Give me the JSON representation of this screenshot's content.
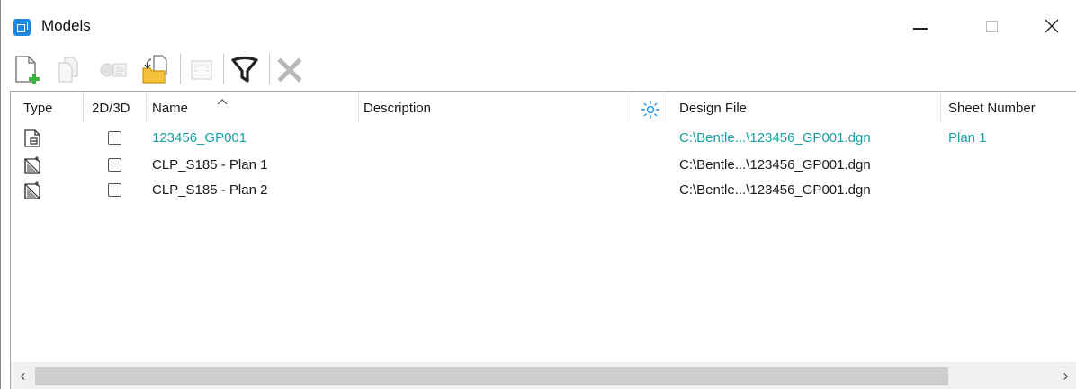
{
  "window": {
    "title": "Models",
    "controls": [
      "minimize",
      "maximize",
      "close"
    ]
  },
  "toolbar": {
    "buttons": [
      {
        "name": "create-model",
        "icon": "new-document-plus-icon",
        "enabled": true
      },
      {
        "name": "copy-model",
        "icon": "copy-icon",
        "enabled": false
      },
      {
        "name": "properties",
        "icon": "info-card-icon",
        "enabled": false
      },
      {
        "name": "import",
        "icon": "folder-import-icon",
        "enabled": true
      },
      {
        "name": "select-all",
        "icon": "select-box-icon",
        "enabled": false
      },
      {
        "name": "filter",
        "icon": "filter-icon",
        "enabled": true
      },
      {
        "name": "delete",
        "icon": "delete-x-icon",
        "enabled": false
      }
    ]
  },
  "table": {
    "columns": {
      "type": "Type",
      "dim": "2D/3D",
      "name": "Name",
      "description": "Description",
      "design_file": "Design File",
      "sheet_number": "Sheet Number"
    },
    "sort": {
      "column": "Name",
      "direction": "ascending",
      "icon": "caret-up-icon"
    },
    "active_icon": "sun-icon",
    "rows": [
      {
        "type_icon": "sheet-model-icon",
        "name": "123456_GP001",
        "description": "",
        "design_file": "C:\\Bentle...\\123456_GP001.dgn",
        "sheet_number": "Plan 1",
        "active": true
      },
      {
        "type_icon": "drawing-model-icon",
        "name": "CLP_S185 - Plan 1",
        "description": "",
        "design_file": "C:\\Bentle...\\123456_GP001.dgn",
        "sheet_number": "",
        "active": false
      },
      {
        "type_icon": "drawing-model-icon",
        "name": "CLP_S185 - Plan 2",
        "description": "",
        "design_file": "C:\\Bentle...\\123456_GP001.dgn",
        "sheet_number": "",
        "active": false
      }
    ]
  },
  "colors": {
    "active_text": "#16a0a3",
    "app_icon": "#1e88e5",
    "sun_icon": "#2196f3"
  }
}
